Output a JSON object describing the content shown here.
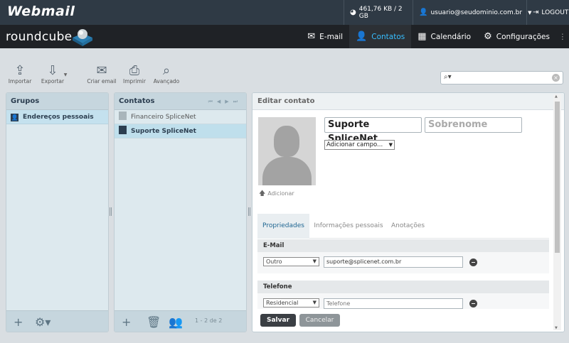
{
  "topbar": {
    "brand": "Webmail",
    "quota": "461,76 KB / 2 GB",
    "user": "usuario@seudominio.com.br",
    "logout": "LOGOUT"
  },
  "header": {
    "logo": "roundcube",
    "nav": [
      {
        "label": "E-mail",
        "icon": "envelope-icon"
      },
      {
        "label": "Contatos",
        "icon": "person-icon",
        "active": true
      },
      {
        "label": "Calendário",
        "icon": "calendar-icon"
      },
      {
        "label": "Configurações",
        "icon": "gear-icon"
      }
    ]
  },
  "toolbar": {
    "import": "Importar",
    "export": "Exportar",
    "compose": "Criar email",
    "print": "Imprimir",
    "advanced": "Avançado"
  },
  "groups": {
    "title": "Grupos",
    "items": [
      "Endereços pessoais"
    ]
  },
  "contacts": {
    "title": "Contatos",
    "rows": [
      "Financeiro SpliceNet",
      "Suporte SpliceNet"
    ],
    "count": "1 - 2 de 2"
  },
  "editor": {
    "title": "Editar contato",
    "add_photo": "Adicionar",
    "first_name": "Suporte SpliceNet",
    "last_name_placeholder": "Sobrenome",
    "add_field": "Adicionar campo...",
    "tabs": [
      "Propriedades",
      "Informações pessoais",
      "Anotações"
    ],
    "email_legend": "E-Mail",
    "email_type": "Outro",
    "email_value": "suporte@splicenet.com.br",
    "phone_legend": "Telefone",
    "phone_type": "Residencial",
    "phone_placeholder": "Telefone",
    "save": "Salvar",
    "cancel": "Cancelar"
  },
  "colors": {
    "accent": "#37beff",
    "topbar": "#2f3a45",
    "header": "#1f2226"
  }
}
